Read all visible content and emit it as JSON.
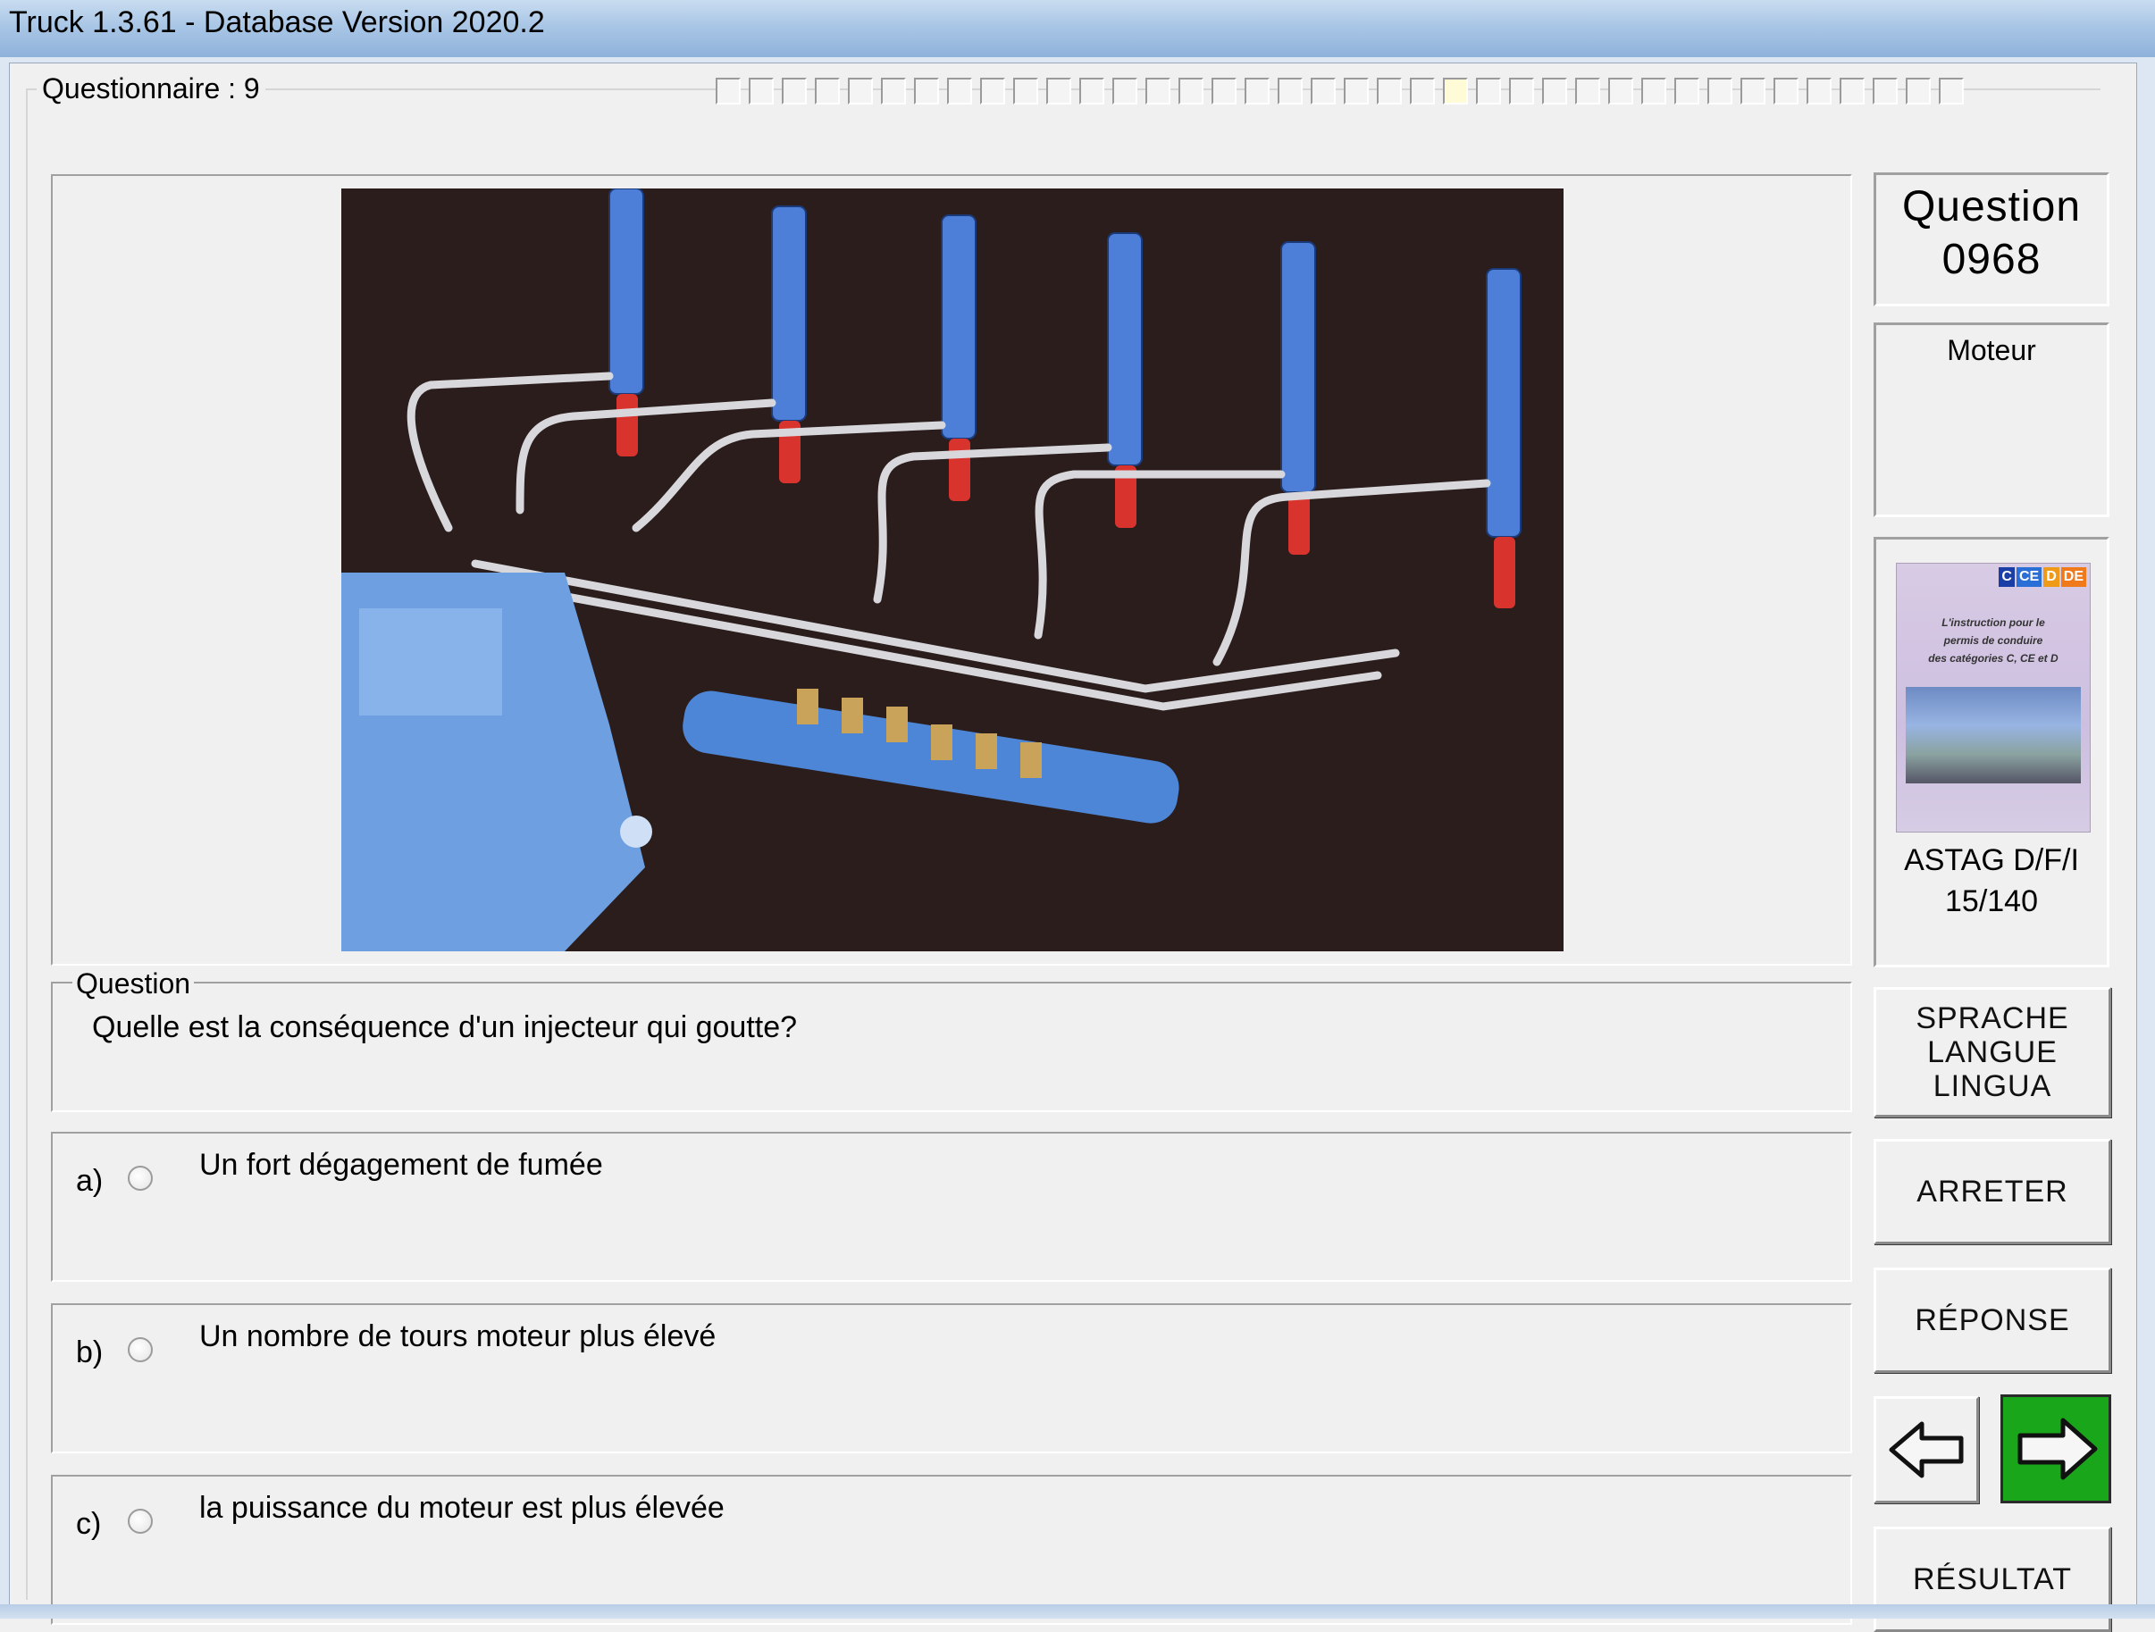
{
  "window": {
    "title": "Truck 1.3.61 - Database Version 2020.2"
  },
  "questionnaire": {
    "label": "Questionnaire : 9",
    "progress_total": 38,
    "progress_current": 22
  },
  "question": {
    "group_label": "Question",
    "text": "Quelle est la conséquence d'un injecteur qui goutte?"
  },
  "answers": [
    {
      "letter": "a)",
      "text": "Un fort dégagement de fumée"
    },
    {
      "letter": "b)",
      "text": "Un nombre de tours moteur plus élevé"
    },
    {
      "letter": "c)",
      "text": "la puissance du moteur est plus élevée"
    }
  ],
  "sidebar": {
    "question_label": "Question",
    "question_number": "0968",
    "category": "Moteur",
    "book": {
      "badges": [
        "C",
        "CE",
        "D",
        "DE"
      ],
      "badge_colors": [
        "#1a3da6",
        "#2a6fd6",
        "#f09a1a",
        "#f07a1a"
      ],
      "cover_lines": [
        "L'instruction pour le",
        "permis de conduire",
        "des catégories C, CE et D"
      ],
      "caption": "ASTAG D/F/I",
      "page": "15/140"
    },
    "buttons": {
      "language": [
        "SPRACHE",
        "LANGUE",
        "LINGUA"
      ],
      "stop": "ARRETER",
      "answer": "RÉPONSE",
      "result": "RÉSULTAT"
    },
    "nav": {
      "prev": "arrow-left-icon",
      "next": "arrow-right-icon",
      "next_color": "#1aa61a"
    }
  }
}
